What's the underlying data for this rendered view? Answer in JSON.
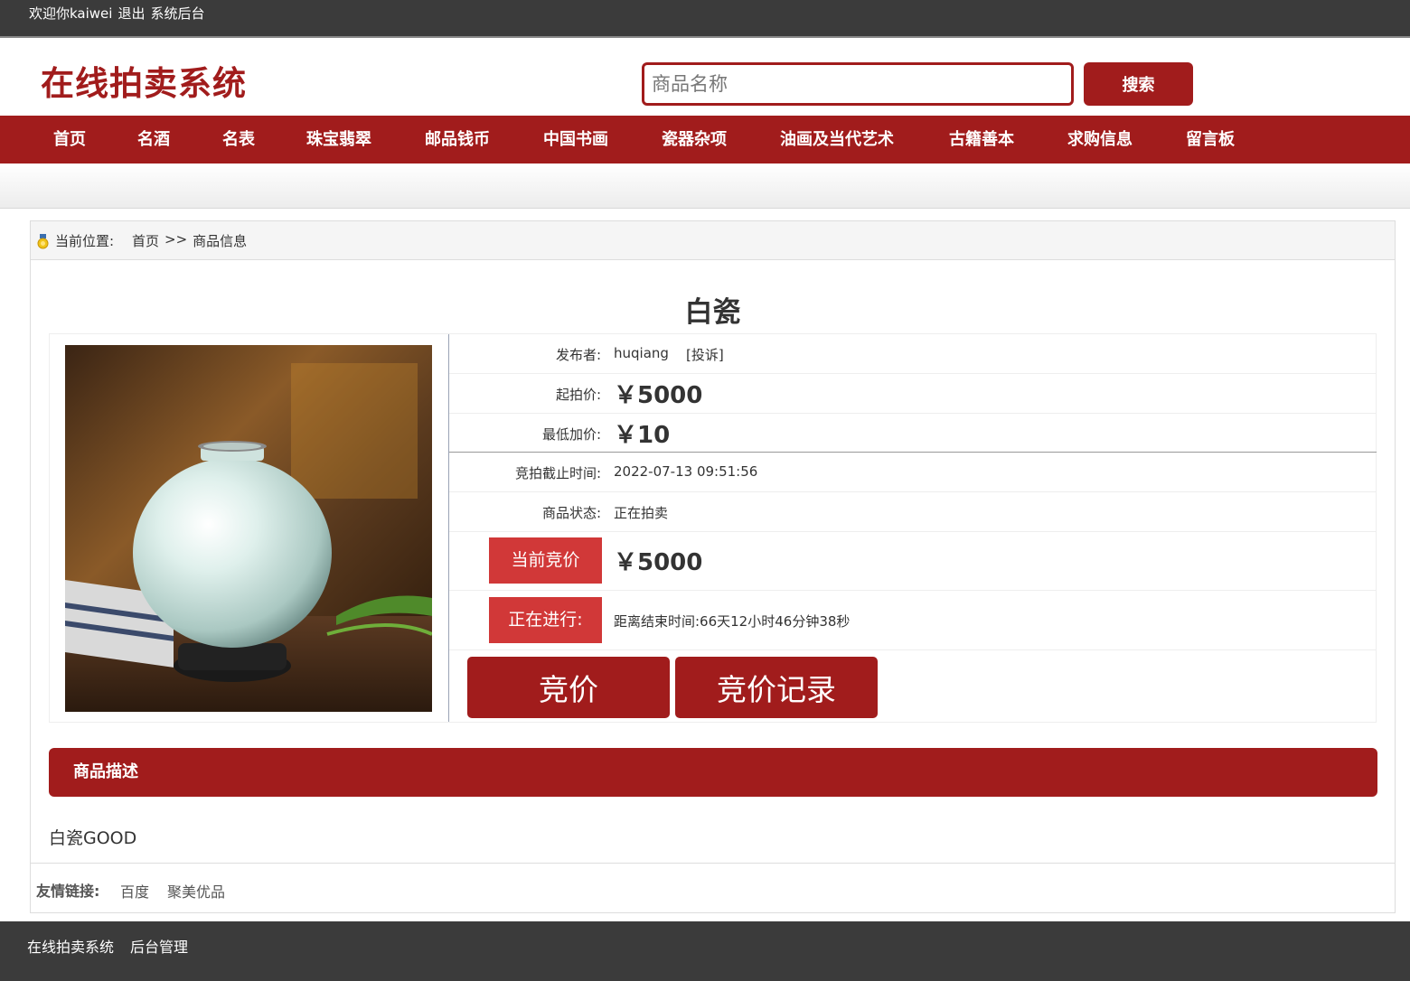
{
  "topbar": {
    "welcome": "欢迎你kaiwei",
    "logout": "退出",
    "admin": "系统后台"
  },
  "header": {
    "logo": "在线拍卖系统",
    "search_placeholder": "商品名称",
    "search_button": "搜索"
  },
  "nav": [
    "首页",
    "名酒",
    "名表",
    "珠宝翡翠",
    "邮品钱币",
    "中国书画",
    "瓷器杂项",
    "油画及当代艺术",
    "古籍善本",
    "求购信息",
    "留言板"
  ],
  "breadcrumb": {
    "label": "当前位置:",
    "home": "首页",
    "sep": ">>",
    "current": "商品信息"
  },
  "product": {
    "title": "白瓷",
    "publisher_label": "发布者:",
    "publisher": "huqiang",
    "report": "[投诉]",
    "start_price_label": "起拍价:",
    "start_price": "￥5000",
    "min_increment_label": "最低加价:",
    "min_increment": "￥10",
    "deadline_label": "竞拍截止时间:",
    "deadline": "2022-07-13 09:51:56",
    "status_label": "商品状态:",
    "status": "正在拍卖",
    "current_bid_label": "当前竞价",
    "current_bid": "￥5000",
    "progress_label": "正在进行:",
    "countdown": "距离结束时间:66天12小时46分钟38秒",
    "bid_button": "竞价",
    "history_button": "竞价记录"
  },
  "description": {
    "heading": "商品描述",
    "text": "白瓷GOOD"
  },
  "friend_links": {
    "label": "友情链接:",
    "items": [
      "百度",
      "聚美优品"
    ]
  },
  "footer": {
    "site": "在线拍卖系统",
    "admin": "后台管理"
  },
  "colors": {
    "brand": "#a11c1c",
    "accent_red": "#d13838",
    "dark": "#3b3b3b"
  }
}
